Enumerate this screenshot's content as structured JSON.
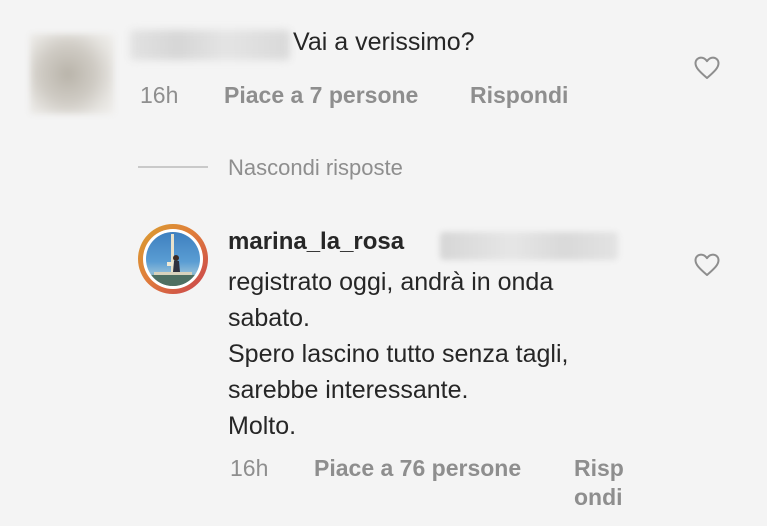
{
  "comment": {
    "text": "Vai a verissimo?",
    "time": "16h",
    "likes": "Piace a 7 persone",
    "reply": "Rispondi"
  },
  "replies_toggle": {
    "label": "Nascondi risposte"
  },
  "reply": {
    "username": "marina_la_rosa",
    "lines": [
      "registrato oggi, andrà in onda",
      "sabato.",
      "Spero lascino tutto senza tagli,",
      "sarebbe interessante.",
      "Molto."
    ],
    "time": "16h",
    "likes": "Piace a 76 persone",
    "reply_line1": "Risp",
    "reply_line2": "ondi"
  },
  "icons": {
    "like": "heart-outline-icon"
  }
}
